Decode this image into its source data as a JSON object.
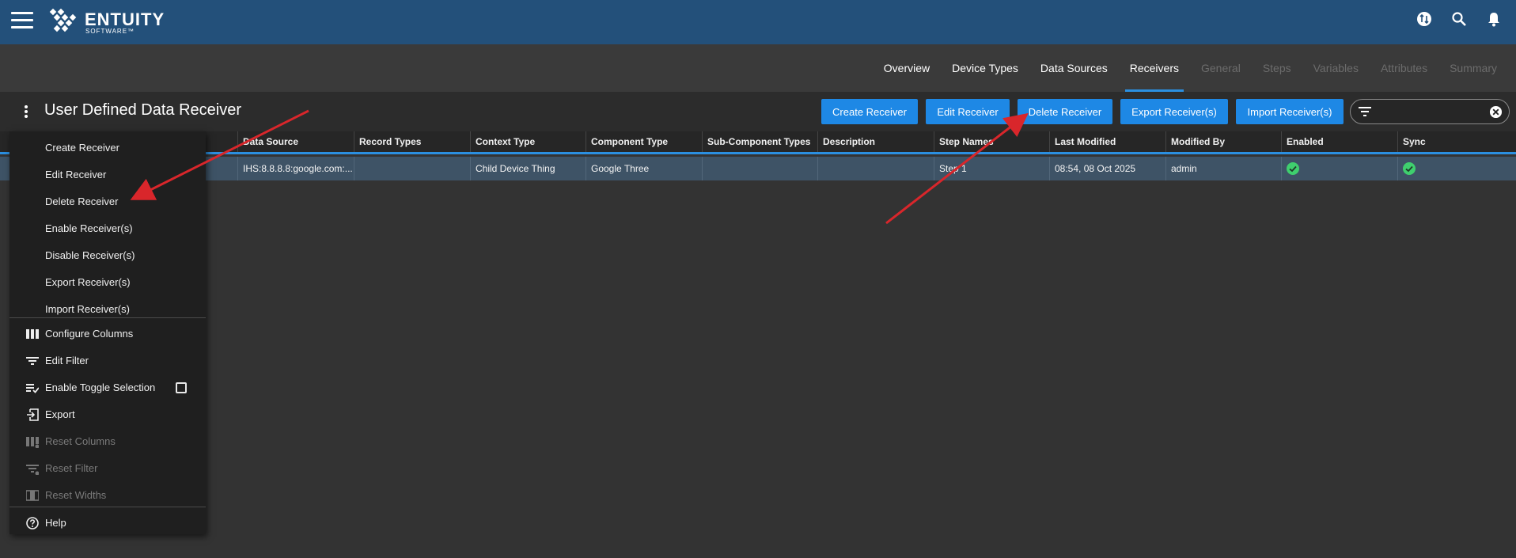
{
  "header": {
    "logo_text": "ENTUITY",
    "logo_sub": "SOFTWARE™"
  },
  "tabs": [
    {
      "label": "Overview",
      "state": "normal"
    },
    {
      "label": "Device Types",
      "state": "normal"
    },
    {
      "label": "Data Sources",
      "state": "normal"
    },
    {
      "label": "Receivers",
      "state": "active"
    },
    {
      "label": "General",
      "state": "disabled"
    },
    {
      "label": "Steps",
      "state": "disabled"
    },
    {
      "label": "Variables",
      "state": "disabled"
    },
    {
      "label": "Attributes",
      "state": "disabled"
    },
    {
      "label": "Summary",
      "state": "disabled"
    }
  ],
  "toolbar": {
    "title": "User Defined Data Receiver",
    "create_label": "Create Receiver",
    "edit_label": "Edit Receiver",
    "delete_label": "Delete Receiver",
    "export_label": "Export Receiver(s)",
    "import_label": "Import Receiver(s)",
    "filter_value": ""
  },
  "table": {
    "columns": [
      "Data Source",
      "Record Types",
      "Context Type",
      "Component Type",
      "Sub-Component Types",
      "Description",
      "Step Names",
      "Last Modified",
      "Modified By",
      "Enabled",
      "Sync"
    ],
    "rows": [
      {
        "data_source": "IHS:8.8.8.8:google.com:...",
        "record_types": "",
        "context_type": "Child Device Thing",
        "component_type": "Google Three",
        "sub_component_types": "",
        "description": "",
        "step_names": "Step 1",
        "last_modified": "08:54, 08 Oct 2025",
        "modified_by": "admin",
        "enabled": true,
        "sync": true
      }
    ]
  },
  "menu": {
    "items": [
      {
        "label": "Create Receiver"
      },
      {
        "label": "Edit Receiver"
      },
      {
        "label": "Delete Receiver"
      },
      {
        "label": "Enable Receiver(s)"
      },
      {
        "label": "Disable Receiver(s)"
      },
      {
        "label": "Export Receiver(s)"
      },
      {
        "label": "Import Receiver(s)"
      }
    ],
    "tools": [
      {
        "label": "Configure Columns",
        "icon": "columns-icon"
      },
      {
        "label": "Edit Filter",
        "icon": "filter-icon"
      },
      {
        "label": "Enable Toggle Selection",
        "icon": "toggle-selection-icon",
        "checked": false
      },
      {
        "label": "Export",
        "icon": "export-icon"
      },
      {
        "label": "Reset Columns",
        "icon": "reset-columns-icon",
        "disabled": true
      },
      {
        "label": "Reset Filter",
        "icon": "reset-filter-icon",
        "disabled": true
      },
      {
        "label": "Reset Widths",
        "icon": "reset-widths-icon",
        "disabled": true
      }
    ],
    "help_label": "Help"
  },
  "colors": {
    "header_bg": "#23507a",
    "accent": "#1e88e5",
    "enabled_check": "#3fcf6e",
    "annotation_arrow": "#d9262b"
  }
}
